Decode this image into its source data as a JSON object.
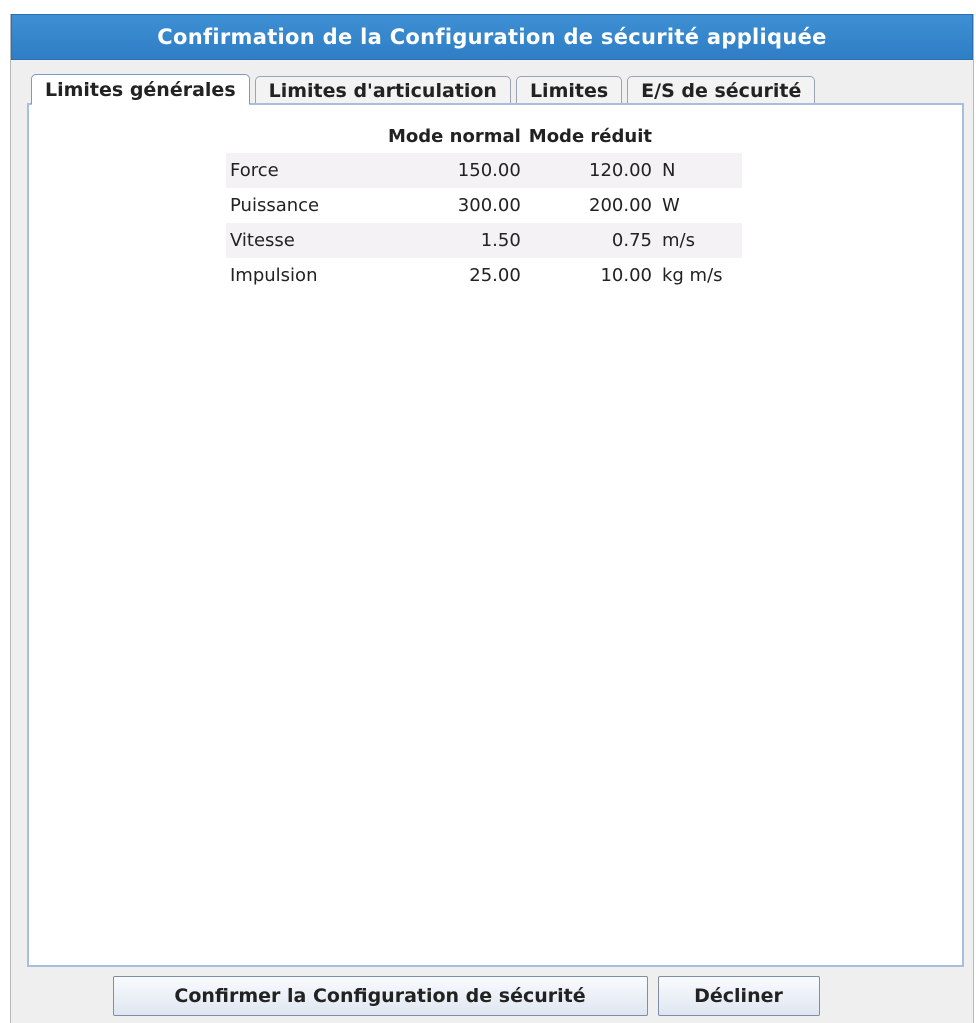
{
  "dialog": {
    "title": "Confirmation de la Configuration de sécurité appliquée"
  },
  "tabs": [
    {
      "label": "Limites générales",
      "active": true
    },
    {
      "label": "Limites d'articulation",
      "active": false
    },
    {
      "label": "Limites",
      "active": false
    },
    {
      "label": "E/S de sécurité",
      "active": false
    }
  ],
  "table": {
    "headers": [
      "",
      "Mode normal",
      "Mode réduit",
      ""
    ],
    "rows": [
      {
        "name": "Force",
        "normal": "150.00",
        "reduced": "120.00",
        "unit": "N"
      },
      {
        "name": "Puissance",
        "normal": "300.00",
        "reduced": "200.00",
        "unit": "W"
      },
      {
        "name": "Vitesse",
        "normal": "1.50",
        "reduced": "0.75",
        "unit": "m/s"
      },
      {
        "name": "Impulsion",
        "normal": "25.00",
        "reduced": "10.00",
        "unit": "kg m/s"
      }
    ]
  },
  "buttons": {
    "confirm_label": "Confirmer la Configuration de sécurité",
    "decline_label": "Décliner"
  },
  "colors": {
    "titlebar": "#2f7ec6",
    "panel_border": "#a9bde0",
    "row_stripe": "#f5f2f5"
  }
}
